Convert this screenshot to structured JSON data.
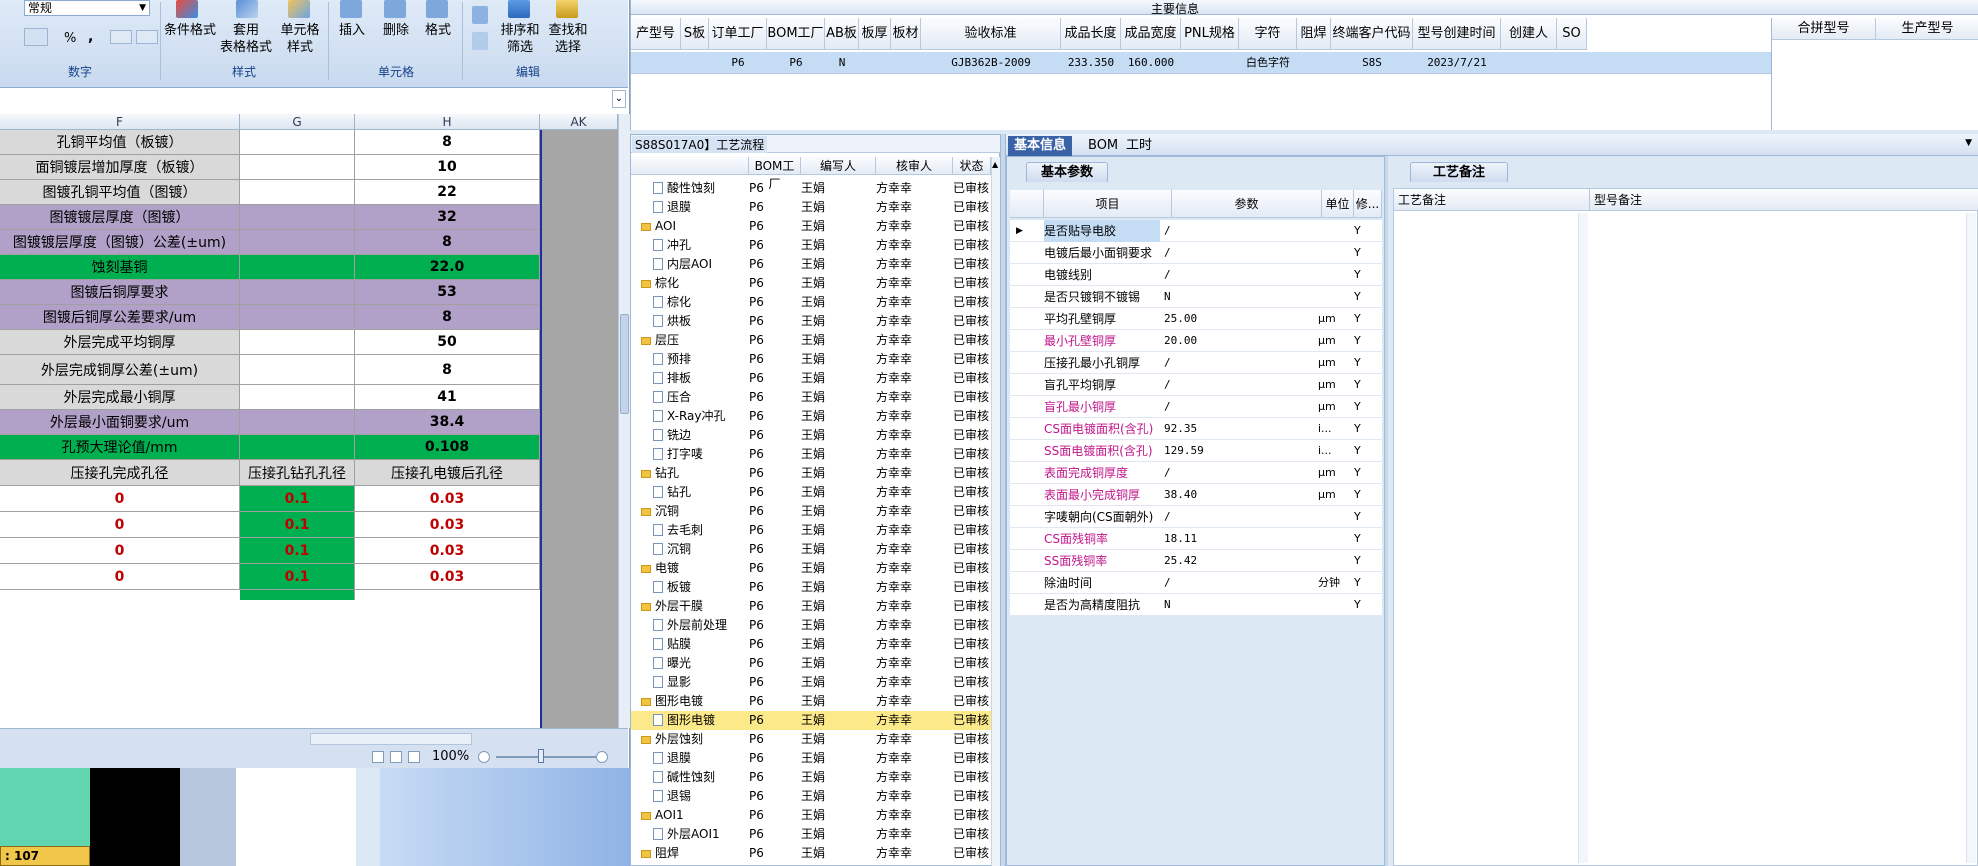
{
  "top": {
    "header": "主要信息",
    "columns": [
      "产型号",
      "S板",
      "订单工厂",
      "BOM工厂",
      "AB板",
      "板厚",
      "板材",
      "验收标准",
      "成品长度",
      "成品宽度",
      "PNL规格",
      "字符",
      "阻焊",
      "终端客户代码",
      "型号创建时间",
      "创建人",
      "SO"
    ],
    "row": [
      "",
      "",
      "P6",
      "P6",
      "N",
      "",
      "",
      "GJB362B-2009",
      "233.350",
      "160.000",
      "",
      "白色字符",
      "",
      "S8S",
      "2023/7/21",
      "",
      ""
    ],
    "right_columns": [
      "合拼型号",
      "生产型号"
    ]
  },
  "excel": {
    "format_value": "常规",
    "ribbon_buttons": [
      {
        "label": "条件格式"
      },
      {
        "label": "套用\n表格格式"
      },
      {
        "label": "单元格\n样式"
      },
      {
        "label": "插入"
      },
      {
        "label": "删除"
      },
      {
        "label": "格式"
      },
      {
        "label": "排序和\n筛选"
      },
      {
        "label": "查找和\n选择"
      }
    ],
    "group_labels": [
      "数字",
      "样式",
      "单元格",
      "编辑"
    ],
    "number_symbols": [
      "%",
      ","
    ],
    "col_headers": [
      "F",
      "G",
      "H",
      "AK"
    ],
    "rows": [
      {
        "f": "孔铜平均值（板镀）",
        "h": "8",
        "bg": "gray"
      },
      {
        "f": "面铜镀层增加厚度（板镀）",
        "h": "10",
        "bg": "gray"
      },
      {
        "f": "图镀孔铜平均值（图镀）",
        "h": "22",
        "bg": "gray"
      },
      {
        "f": "图镀镀层厚度（图镀）",
        "h": "32",
        "bg": "purple"
      },
      {
        "f": "图镀镀层厚度（图镀）公差(±um)",
        "h": "8",
        "bg": "purple"
      },
      {
        "f": "蚀刻基铜",
        "h": "22.0",
        "bg": "green"
      },
      {
        "f": "图镀后铜厚要求",
        "h": "53",
        "bg": "purple"
      },
      {
        "f": "图镀后铜厚公差要求/um",
        "h": "8",
        "bg": "purple"
      },
      {
        "f": "外层完成平均铜厚",
        "h": "50",
        "bg": "gray"
      },
      {
        "f": "外层完成铜厚公差(±um)",
        "h": "8",
        "bg": "gray"
      },
      {
        "f": "外层完成最小铜厚",
        "h": "41",
        "bg": "gray"
      },
      {
        "f": "外层最小面铜要求/um",
        "h": "38.4",
        "bg": "purple"
      },
      {
        "f": "孔预大理论值/mm",
        "h": "0.108",
        "bg": "green"
      }
    ],
    "sub_header": [
      "压接孔完成孔径",
      "压接孔钻孔孔径",
      "压接孔电镀后孔径"
    ],
    "sub_rows": [
      [
        "0",
        "0.1",
        "0.03"
      ],
      [
        "0",
        "0.1",
        "0.03"
      ],
      [
        "0",
        "0.1",
        "0.03"
      ],
      [
        "0",
        "0.1",
        "0.03"
      ]
    ],
    "zoom": "100%",
    "status_value": ": 107"
  },
  "tree": {
    "title": "S88S017A0】工艺流程",
    "columns": [
      "",
      "BOM工厂",
      "编写人",
      "核审人",
      "状态"
    ],
    "rows": [
      {
        "name": "酸性蚀刻",
        "lv": 2,
        "bom": "P6",
        "w": "王娟",
        "r": "方幸幸",
        "s": "已审核"
      },
      {
        "name": "退膜",
        "lv": 2,
        "bom": "P6",
        "w": "王娟",
        "r": "方幸幸",
        "s": "已审核"
      },
      {
        "name": "AOI",
        "lv": 1,
        "bom": "P6",
        "w": "王娟",
        "r": "方幸幸",
        "s": "已审核"
      },
      {
        "name": "冲孔",
        "lv": 2,
        "bom": "P6",
        "w": "王娟",
        "r": "方幸幸",
        "s": "已审核"
      },
      {
        "name": "内层AOI",
        "lv": 2,
        "bom": "P6",
        "w": "王娟",
        "r": "方幸幸",
        "s": "已审核"
      },
      {
        "name": "棕化",
        "lv": 1,
        "bom": "P6",
        "w": "王娟",
        "r": "方幸幸",
        "s": "已审核"
      },
      {
        "name": "棕化",
        "lv": 2,
        "bom": "P6",
        "w": "王娟",
        "r": "方幸幸",
        "s": "已审核"
      },
      {
        "name": "烘板",
        "lv": 2,
        "bom": "P6",
        "w": "王娟",
        "r": "方幸幸",
        "s": "已审核"
      },
      {
        "name": "层压",
        "lv": 1,
        "bom": "P6",
        "w": "王娟",
        "r": "方幸幸",
        "s": "已审核"
      },
      {
        "name": "预排",
        "lv": 2,
        "bom": "P6",
        "w": "王娟",
        "r": "方幸幸",
        "s": "已审核"
      },
      {
        "name": "排板",
        "lv": 2,
        "bom": "P6",
        "w": "王娟",
        "r": "方幸幸",
        "s": "已审核"
      },
      {
        "name": "压合",
        "lv": 2,
        "bom": "P6",
        "w": "王娟",
        "r": "方幸幸",
        "s": "已审核"
      },
      {
        "name": "X-Ray冲孔",
        "lv": 2,
        "bom": "P6",
        "w": "王娟",
        "r": "方幸幸",
        "s": "已审核"
      },
      {
        "name": "铣边",
        "lv": 2,
        "bom": "P6",
        "w": "王娟",
        "r": "方幸幸",
        "s": "已审核"
      },
      {
        "name": "打字唛",
        "lv": 2,
        "bom": "P6",
        "w": "王娟",
        "r": "方幸幸",
        "s": "已审核"
      },
      {
        "name": "钻孔",
        "lv": 1,
        "bom": "P6",
        "w": "王娟",
        "r": "方幸幸",
        "s": "已审核"
      },
      {
        "name": "钻孔",
        "lv": 2,
        "bom": "P6",
        "w": "王娟",
        "r": "方幸幸",
        "s": "已审核"
      },
      {
        "name": "沉铜",
        "lv": 1,
        "bom": "P6",
        "w": "王娟",
        "r": "方幸幸",
        "s": "已审核"
      },
      {
        "name": "去毛刺",
        "lv": 2,
        "bom": "P6",
        "w": "王娟",
        "r": "方幸幸",
        "s": "已审核"
      },
      {
        "name": "沉铜",
        "lv": 2,
        "bom": "P6",
        "w": "王娟",
        "r": "方幸幸",
        "s": "已审核"
      },
      {
        "name": "电镀",
        "lv": 1,
        "bom": "P6",
        "w": "王娟",
        "r": "方幸幸",
        "s": "已审核"
      },
      {
        "name": "板镀",
        "lv": 2,
        "bom": "P6",
        "w": "王娟",
        "r": "方幸幸",
        "s": "已审核"
      },
      {
        "name": "外层干膜",
        "lv": 1,
        "bom": "P6",
        "w": "王娟",
        "r": "方幸幸",
        "s": "已审核"
      },
      {
        "name": "外层前处理",
        "lv": 2,
        "bom": "P6",
        "w": "王娟",
        "r": "方幸幸",
        "s": "已审核"
      },
      {
        "name": "贴膜",
        "lv": 2,
        "bom": "P6",
        "w": "王娟",
        "r": "方幸幸",
        "s": "已审核"
      },
      {
        "name": "曝光",
        "lv": 2,
        "bom": "P6",
        "w": "王娟",
        "r": "方幸幸",
        "s": "已审核"
      },
      {
        "name": "显影",
        "lv": 2,
        "bom": "P6",
        "w": "王娟",
        "r": "方幸幸",
        "s": "已审核"
      },
      {
        "name": "图形电镀",
        "lv": 1,
        "bom": "P6",
        "w": "王娟",
        "r": "方幸幸",
        "s": "已审核"
      },
      {
        "name": "图形电镀",
        "lv": 2,
        "bom": "P6",
        "w": "王娟",
        "r": "方幸幸",
        "s": "已审核",
        "sel": true
      },
      {
        "name": "外层蚀刻",
        "lv": 1,
        "bom": "P6",
        "w": "王娟",
        "r": "方幸幸",
        "s": "已审核"
      },
      {
        "name": "退膜",
        "lv": 2,
        "bom": "P6",
        "w": "王娟",
        "r": "方幸幸",
        "s": "已审核"
      },
      {
        "name": "碱性蚀刻",
        "lv": 2,
        "bom": "P6",
        "w": "王娟",
        "r": "方幸幸",
        "s": "已审核"
      },
      {
        "name": "退锡",
        "lv": 2,
        "bom": "P6",
        "w": "王娟",
        "r": "方幸幸",
        "s": "已审核"
      },
      {
        "name": "AOI1",
        "lv": 1,
        "bom": "P6",
        "w": "王娟",
        "r": "方幸幸",
        "s": "已审核"
      },
      {
        "name": "外层AOI1",
        "lv": 2,
        "bom": "P6",
        "w": "王娟",
        "r": "方幸幸",
        "s": "已审核"
      },
      {
        "name": "阻焊",
        "lv": 1,
        "bom": "P6",
        "w": "王娟",
        "r": "方幸幸",
        "s": "已审核"
      }
    ]
  },
  "info": {
    "tabs": [
      "基本信息",
      "BOM",
      "工时"
    ],
    "panel_title": "基本参数",
    "columns": [
      "项目",
      "参数",
      "单位",
      "修..."
    ],
    "rows": [
      {
        "k": "是否贴导电胶",
        "v": "/",
        "u": "",
        "m": "Y",
        "pink": false
      },
      {
        "k": "电镀后最小面铜要求",
        "v": "/",
        "u": "",
        "m": "Y",
        "pink": false
      },
      {
        "k": "电镀线别",
        "v": "/",
        "u": "",
        "m": "Y",
        "pink": false
      },
      {
        "k": "是否只镀铜不镀锡",
        "v": "N",
        "u": "",
        "m": "Y",
        "pink": false
      },
      {
        "k": "平均孔壁铜厚",
        "v": "25.00",
        "u": "μm",
        "m": "Y",
        "pink": false
      },
      {
        "k": "最小孔壁铜厚",
        "v": "20.00",
        "u": "μm",
        "m": "Y",
        "pink": true
      },
      {
        "k": "压接孔最小孔铜厚",
        "v": "/",
        "u": "μm",
        "m": "Y",
        "pink": false
      },
      {
        "k": "盲孔平均铜厚",
        "v": "/",
        "u": "μm",
        "m": "Y",
        "pink": false
      },
      {
        "k": "盲孔最小铜厚",
        "v": "/",
        "u": "μm",
        "m": "Y",
        "pink": true
      },
      {
        "k": "CS面电镀面积(含孔)",
        "v": "92.35",
        "u": "i...",
        "m": "Y",
        "pink": true
      },
      {
        "k": "SS面电镀面积(含孔)",
        "v": "129.59",
        "u": "i...",
        "m": "Y",
        "pink": true
      },
      {
        "k": "表面完成铜厚度",
        "v": "/",
        "u": "μm",
        "m": "Y",
        "pink": true
      },
      {
        "k": "表面最小完成铜厚",
        "v": "38.40",
        "u": "μm",
        "m": "Y",
        "pink": true
      },
      {
        "k": "字唛朝向(CS面朝外)",
        "v": "/",
        "u": "",
        "m": "Y",
        "pink": false
      },
      {
        "k": "CS面残铜率",
        "v": "18.11",
        "u": "",
        "m": "Y",
        "pink": true
      },
      {
        "k": "SS面残铜率",
        "v": "25.42",
        "u": "",
        "m": "Y",
        "pink": true
      },
      {
        "k": "除油时间",
        "v": "/",
        "u": "分钟",
        "m": "Y",
        "pink": false
      },
      {
        "k": "是否为高精度阻抗",
        "v": "N",
        "u": "",
        "m": "Y",
        "pink": false
      }
    ]
  },
  "remark": {
    "panel_title": "工艺备注",
    "columns": [
      "工艺备注",
      "型号备注"
    ]
  }
}
